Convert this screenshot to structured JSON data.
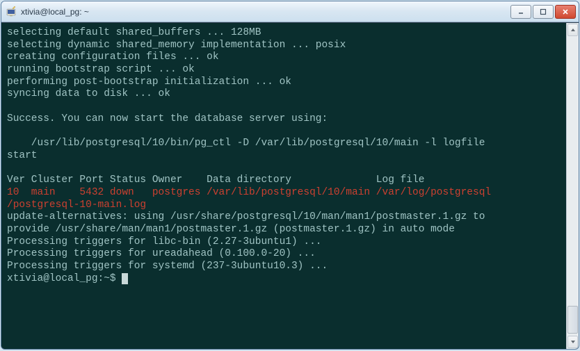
{
  "window": {
    "title": "xtivia@local_pg: ~"
  },
  "terminal": {
    "lines": [
      {
        "text": "selecting default shared_buffers ... 128MB",
        "cls": "g"
      },
      {
        "text": "selecting dynamic shared_memory implementation ... posix",
        "cls": "g"
      },
      {
        "text": "creating configuration files ... ok",
        "cls": "g"
      },
      {
        "text": "running bootstrap script ... ok",
        "cls": "g"
      },
      {
        "text": "performing post-bootstrap initialization ... ok",
        "cls": "g"
      },
      {
        "text": "syncing data to disk ... ok",
        "cls": "g"
      },
      {
        "text": "",
        "cls": "g"
      },
      {
        "text": "Success. You can now start the database server using:",
        "cls": "g"
      },
      {
        "text": "",
        "cls": "g"
      },
      {
        "text": "    /usr/lib/postgresql/10/bin/pg_ctl -D /var/lib/postgresql/10/main -l logfile",
        "cls": "g"
      },
      {
        "text": "start",
        "cls": "g"
      },
      {
        "text": "",
        "cls": "g"
      },
      {
        "text": "Ver Cluster Port Status Owner    Data directory              Log file",
        "cls": "g"
      },
      {
        "text": "10  main    5432 down   postgres /var/lib/postgresql/10/main /var/log/postgresql",
        "cls": "r"
      },
      {
        "text": "/postgresql-10-main.log",
        "cls": "r"
      },
      {
        "text": "update-alternatives: using /usr/share/postgresql/10/man/man1/postmaster.1.gz to",
        "cls": "g"
      },
      {
        "text": "provide /usr/share/man/man1/postmaster.1.gz (postmaster.1.gz) in auto mode",
        "cls": "g"
      },
      {
        "text": "Processing triggers for libc-bin (2.27-3ubuntu1) ...",
        "cls": "g"
      },
      {
        "text": "Processing triggers for ureadahead (0.100.0-20) ...",
        "cls": "g"
      },
      {
        "text": "Processing triggers for systemd (237-3ubuntu10.3) ...",
        "cls": "g"
      }
    ],
    "prompt": "xtivia@local_pg:~$ "
  },
  "colors": {
    "terminal_bg": "#0a2e2e",
    "text_default": "#a0c4c4",
    "text_red": "#cc4030"
  }
}
